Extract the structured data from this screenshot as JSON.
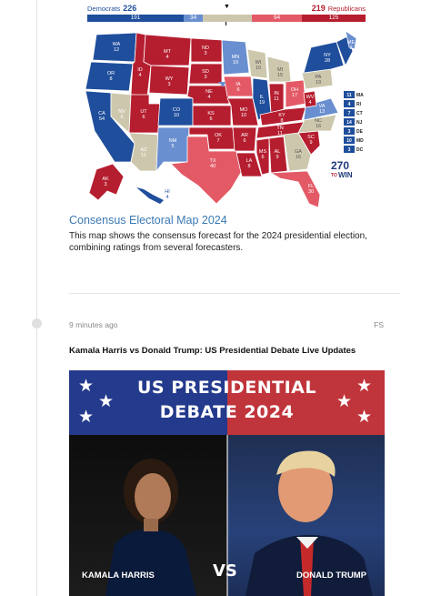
{
  "electoral_bar": {
    "dem_label": "Democrats",
    "dem_total": "226",
    "rep_total": "219",
    "rep_label": "Republicans",
    "marker": "▼",
    "segments": [
      "191",
      "34",
      "",
      "94",
      "125"
    ],
    "colors": {
      "dem_solid": "#1f4e9c",
      "dem_lean": "#6a8fd0",
      "tossup": "#cdc8ad",
      "rep_lean": "#e35a66",
      "rep_solid": "#b51e2f"
    }
  },
  "map": {
    "states": [
      {
        "abbr": "WA",
        "ev": "12"
      },
      {
        "abbr": "OR",
        "ev": "8"
      },
      {
        "abbr": "CA",
        "ev": "54"
      },
      {
        "abbr": "NV",
        "ev": "6"
      },
      {
        "abbr": "ID",
        "ev": "4"
      },
      {
        "abbr": "MT",
        "ev": "4"
      },
      {
        "abbr": "WY",
        "ev": "3"
      },
      {
        "abbr": "UT",
        "ev": "6"
      },
      {
        "abbr": "AZ",
        "ev": "11"
      },
      {
        "abbr": "CO",
        "ev": "10"
      },
      {
        "abbr": "NM",
        "ev": "5"
      },
      {
        "abbr": "ND",
        "ev": "3"
      },
      {
        "abbr": "SD",
        "ev": "3"
      },
      {
        "abbr": "NE",
        "ev": "4"
      },
      {
        "abbr": "KS",
        "ev": "6"
      },
      {
        "abbr": "OK",
        "ev": "7"
      },
      {
        "abbr": "TX",
        "ev": "40"
      },
      {
        "abbr": "MN",
        "ev": "10"
      },
      {
        "abbr": "IA",
        "ev": "6"
      },
      {
        "abbr": "MO",
        "ev": "10"
      },
      {
        "abbr": "AR",
        "ev": "6"
      },
      {
        "abbr": "LA",
        "ev": "8"
      },
      {
        "abbr": "WI",
        "ev": "10"
      },
      {
        "abbr": "IL",
        "ev": "19"
      },
      {
        "abbr": "MI",
        "ev": "15"
      },
      {
        "abbr": "IN",
        "ev": "11"
      },
      {
        "abbr": "OH",
        "ev": "17"
      },
      {
        "abbr": "KY",
        "ev": "8"
      },
      {
        "abbr": "TN",
        "ev": "11"
      },
      {
        "abbr": "MS",
        "ev": "6"
      },
      {
        "abbr": "AL",
        "ev": "9"
      },
      {
        "abbr": "GA",
        "ev": "16"
      },
      {
        "abbr": "FL",
        "ev": "30"
      },
      {
        "abbr": "SC",
        "ev": "9"
      },
      {
        "abbr": "NC",
        "ev": "16"
      },
      {
        "abbr": "VA",
        "ev": "13"
      },
      {
        "abbr": "WV",
        "ev": "4"
      },
      {
        "abbr": "PA",
        "ev": "19"
      },
      {
        "abbr": "NY",
        "ev": "28"
      },
      {
        "abbr": "ME",
        "ev": "2"
      },
      {
        "abbr": "AK",
        "ev": "3"
      },
      {
        "abbr": "HI",
        "ev": "4"
      }
    ],
    "side_boxes": [
      {
        "ev": "11",
        "abbr": "MA"
      },
      {
        "ev": "4",
        "abbr": "RI"
      },
      {
        "ev": "7",
        "abbr": "CT"
      },
      {
        "ev": "14",
        "abbr": "NJ"
      },
      {
        "ev": "3",
        "abbr": "DE"
      },
      {
        "ev": "10",
        "abbr": "MD"
      },
      {
        "ev": "3",
        "abbr": "DC"
      }
    ],
    "logo_top": "270",
    "logo_to": "TO",
    "logo_win": "WIN"
  },
  "caption": {
    "title": "Consensus Electoral Map 2024",
    "description": "This map shows the consensus forecast for the 2024 presidential election, combining ratings from several forecasters."
  },
  "post": {
    "time": "9 minutes ago",
    "author": "FS",
    "headline": "Kamala Harris vs Donald Trump: US Presidential Debate Live Updates"
  },
  "hero": {
    "title_line1": "US PRESIDENTIAL",
    "title_line2": "DEBATE 2024",
    "left_name": "KAMALA HARRIS",
    "right_name": "DONALD TRUMP",
    "vs": "VS"
  }
}
